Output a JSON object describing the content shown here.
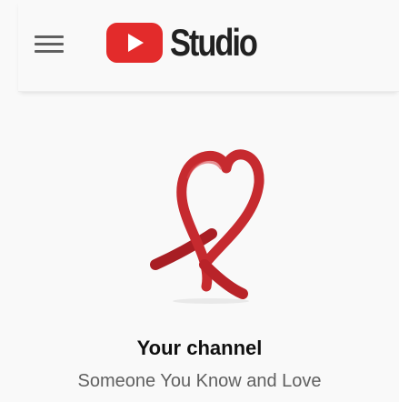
{
  "header": {
    "logo_text": "Studio",
    "logo_icon": "youtube-play-icon",
    "menu_icon": "hamburger-menu-icon"
  },
  "channel": {
    "heading": "Your channel",
    "name": "Someone You Know and Love",
    "avatar_icon": "awareness-ribbon-icon"
  },
  "colors": {
    "brand_red": "#e32b2b",
    "ribbon_red": "#c62a2f",
    "background": "#f9f9f9",
    "title_text": "#0f0f0f",
    "secondary_text": "#606060"
  }
}
